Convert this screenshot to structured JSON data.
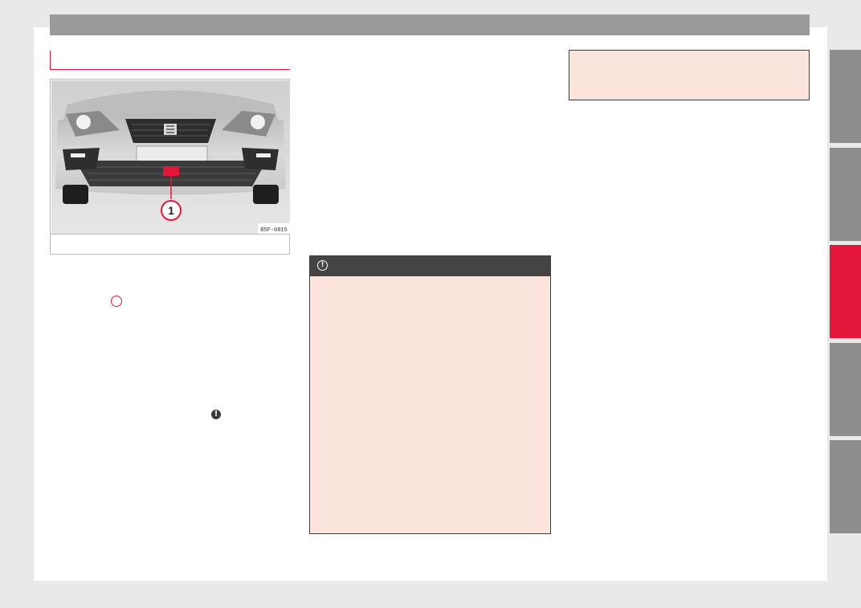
{
  "figure": {
    "callout_number": "1",
    "image_code": "B5F-0815",
    "caption": ""
  },
  "icons": {
    "callout_ref": "callout-1-reference",
    "inline_warning": "warning-exclamation-icon",
    "note_header": "caution-exclamation-icon"
  },
  "note": {
    "icon_symbol": "!"
  },
  "side_tabs": [
    {
      "label": "",
      "active": false
    },
    {
      "label": "",
      "active": false
    },
    {
      "label": "",
      "active": true
    },
    {
      "label": "",
      "active": false
    },
    {
      "label": "",
      "active": false
    }
  ],
  "colors": {
    "accent": "#e3173a",
    "tab_inactive": "#8d8d8d",
    "note_bg": "#fbe4dc",
    "note_header": "#444444",
    "top_bar": "#9a9a9a"
  }
}
